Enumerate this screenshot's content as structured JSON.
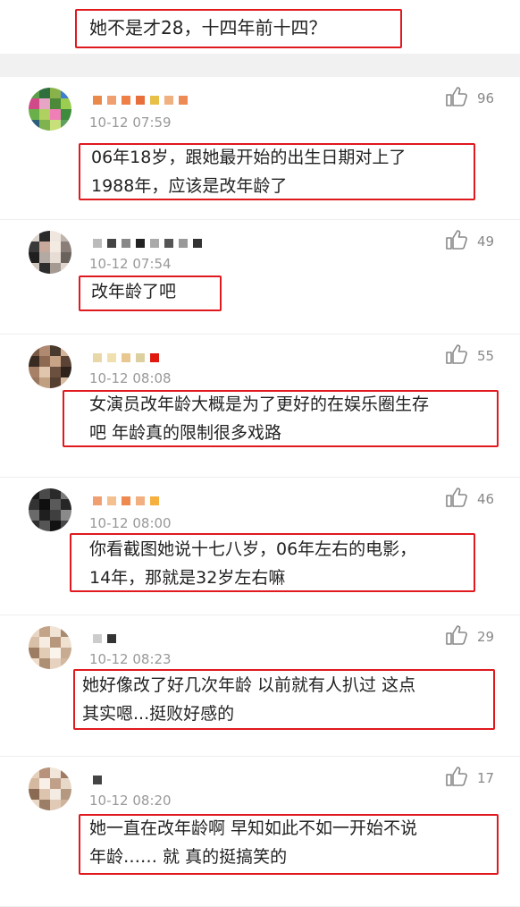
{
  "top_comment": {
    "text": "她不是才28，十四年前十四？"
  },
  "comments": [
    {
      "timestamp": "10-12 07:59",
      "likes": "96",
      "body_lines": [
        "06年18岁，跟她最开始的出生日期对上了",
        "1988年，应该是改年龄了"
      ],
      "avatar_colors": [
        "#5aa04a",
        "#2f6f3d",
        "#8ab24a",
        "#3f7ed1",
        "#d04a8a",
        "#e6a5c4",
        "#4c8a3a",
        "#9acd50",
        "#6ab04a",
        "#b0d060",
        "#ef7fb6",
        "#3d8b3d",
        "#2e5f7a",
        "#7fb34f",
        "#c7e07a",
        "#5f9f5f"
      ],
      "username_colors": [
        "#ea8a4a",
        "#f0a070",
        "#ee7f47",
        "#e86f3a",
        "#e8c048",
        "#f0b080",
        "#ed8a55"
      ]
    },
    {
      "timestamp": "10-12 07:54",
      "likes": "49",
      "body_lines": [
        "改年龄了吧"
      ],
      "avatar_colors": [
        "#d9d3cc",
        "#2a2a2a",
        "#efe6df",
        "#bdb5ad",
        "#3a3a3a",
        "#c7a89a",
        "#f3eae2",
        "#8a7f78",
        "#1f1f1f",
        "#b3aaa3",
        "#e8ddd4",
        "#6a625c",
        "#cfc6be",
        "#2d2d2d",
        "#a59a92",
        "#e0d6cd"
      ],
      "username_colors": [
        "#bbbbbb",
        "#444444",
        "#888888",
        "#222222",
        "#aaaaaa",
        "#555555",
        "#999999",
        "#333333"
      ]
    },
    {
      "timestamp": "10-12 08:08",
      "likes": "55",
      "body_lines": [
        "女演员改年龄大概是为了更好的在娱乐圈生存",
        "吧 年龄真的限制很多戏路"
      ],
      "avatar_colors": [
        "#7a5a45",
        "#b08a70",
        "#4a3a2e",
        "#d2b49a",
        "#3a2b22",
        "#8f6a52",
        "#c9a386",
        "#5b4436",
        "#a88068",
        "#e0c6ad",
        "#6b5040",
        "#2e221b",
        "#9a7860",
        "#c0a080",
        "#553f31",
        "#d8bda3"
      ],
      "username_colors": [
        "#e8d8a8",
        "#f0e0b0",
        "#e8c890",
        "#ddd0a0",
        "#e0190f"
      ]
    },
    {
      "timestamp": "10-12 08:00",
      "likes": "46",
      "body_lines": [
        "你看截图她说十七八岁，06年左右的电影，",
        "14年，那就是32岁左右嘛"
      ],
      "avatar_colors": [
        "#1a1a1a",
        "#4a4a4a",
        "#2a2a2a",
        "#7a7a7a",
        "#333333",
        "#0f0f0f",
        "#5a5a5a",
        "#262626",
        "#6a6a6a",
        "#1f1f1f",
        "#3f3f3f",
        "#8a8a8a",
        "#2f2f2f",
        "#555555",
        "#121212",
        "#474747"
      ],
      "username_colors": [
        "#f0a070",
        "#f5c090",
        "#ee8a50",
        "#f2b080",
        "#f5b040"
      ]
    },
    {
      "timestamp": "10-12 08:23",
      "likes": "29",
      "body_lines": [
        "她好像改了好几次年龄 以前就有人扒过 这点",
        "其实嗯...挺败好感的"
      ],
      "avatar_colors": [
        "#e8d6c4",
        "#c4a488",
        "#f2e4d4",
        "#a88a70",
        "#d8c0a8",
        "#f6ece2",
        "#b8987c",
        "#efe0d0",
        "#9c7c62",
        "#e2ccb6",
        "#fbf4ec",
        "#c8ac92",
        "#f0dcc8",
        "#ad8f74",
        "#e6d2be",
        "#d2b8a0"
      ],
      "username_colors": [
        "#cccccc",
        "#333333"
      ]
    },
    {
      "timestamp": "10-12 08:20",
      "likes": "17",
      "body_lines": [
        "她一直在改年龄啊 早知如此不如一开始不说",
        "年龄…… 就 真的挺搞笑的"
      ],
      "avatar_colors": [
        "#e6d0bc",
        "#b8927a",
        "#f2e6da",
        "#a07a62",
        "#d4b8a0",
        "#f8f0e8",
        "#c0a088",
        "#e8d8c8",
        "#8a6a52",
        "#dcc4ae",
        "#f4ebe2",
        "#b49880",
        "#ead8c6",
        "#9c7e66",
        "#e0cab6",
        "#cfb49c"
      ],
      "username_colors": [
        "#444444"
      ]
    }
  ],
  "colors": {
    "highlight_border": "#e0191f",
    "timestamp": "#999999",
    "like_count": "#888888"
  },
  "icons": {
    "like": "thumbs-up-icon"
  }
}
